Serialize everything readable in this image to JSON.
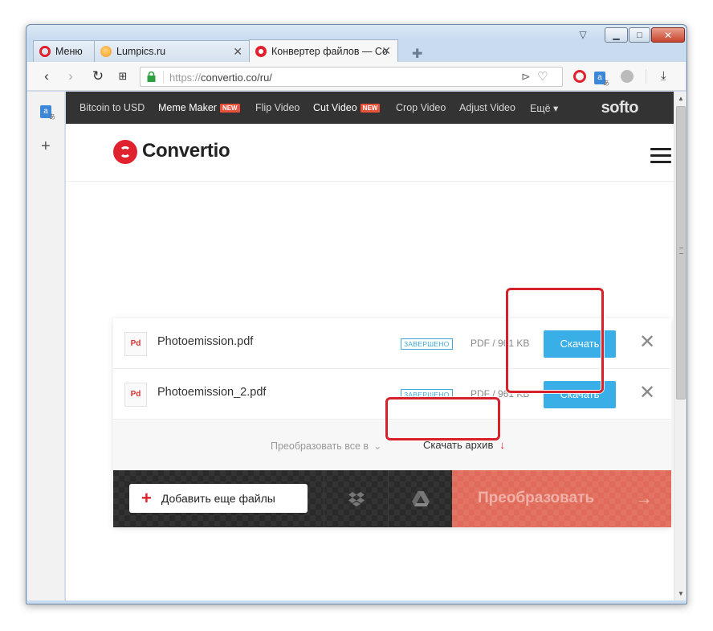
{
  "window": {
    "min_glyph": "▁",
    "max_glyph": "□",
    "close_glyph": "✕",
    "tabmenu_glyph": "▽"
  },
  "tabs": [
    {
      "label": "Меню",
      "icon": "opera-icon"
    },
    {
      "label": "Lumpics.ru",
      "icon": "lumpics-icon"
    },
    {
      "label": "Конвертер файлов — Co",
      "icon": "convertio-icon"
    }
  ],
  "addressbar": {
    "scheme": "https://",
    "url": "convertio.co/ru/"
  },
  "promo": {
    "links": [
      {
        "label": "Bitcoin to USD",
        "new": false
      },
      {
        "label": "Meme Maker",
        "new": true
      },
      {
        "label": "Flip Video",
        "new": false
      },
      {
        "label": "Cut Video",
        "new": true
      },
      {
        "label": "Crop Video",
        "new": false
      },
      {
        "label": "Adjust Video",
        "new": false
      },
      {
        "label": "Ещё ▾",
        "new": false
      }
    ],
    "new_badge": "NEW",
    "brand": "softo"
  },
  "header": {
    "logo_text": "Convertio"
  },
  "files": [
    {
      "icon_label": "Pd",
      "name": "Photoemission.pdf",
      "status": "ЗАВЕРШЕНО",
      "size": "PDF / 961 KB",
      "download_label": "Скачать"
    },
    {
      "icon_label": "Pd",
      "name": "Photoemission_2.pdf",
      "status": "ЗАВЕРШЕНО",
      "size": "PDF / 961 KB",
      "download_label": "Скачать"
    }
  ],
  "midbar": {
    "convert_all": "Преобразовать все в",
    "archive": "Скачать архив"
  },
  "bottombar": {
    "add_files": "Добавить еще файлы",
    "convert": "Преобразовать"
  },
  "colors": {
    "accent": "#e0212e",
    "download_button": "#3aaee6",
    "convert_button": "#e16b5b",
    "highlight": "#d6212a"
  }
}
